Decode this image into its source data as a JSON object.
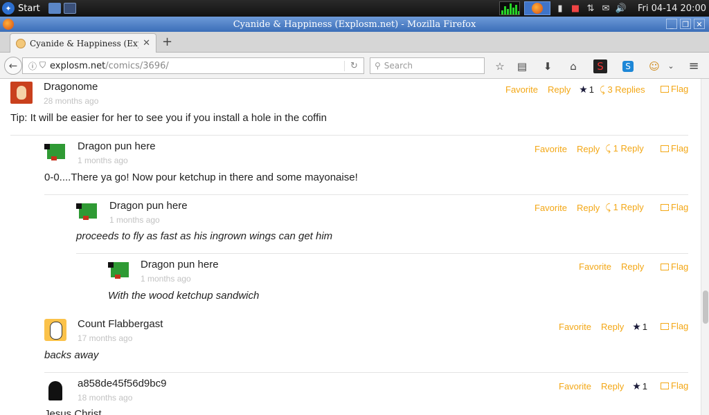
{
  "taskbar": {
    "start_label": "Start",
    "clock": "Fri 04-14 20:00"
  },
  "window": {
    "title": "Cyanide & Happiness (Explosm.net) - Mozilla Firefox"
  },
  "tab": {
    "title": "Cyanide & Happiness (Exp",
    "new_tab": "+"
  },
  "navbar": {
    "url_host": "explosm.net",
    "url_path": "/comics/3696/",
    "search_placeholder": "Search"
  },
  "comments": [
    {
      "name": "Dragonome",
      "time": "28 months ago",
      "text": "Tip: It will be easier for her to see you if you install a hole in the coffin",
      "favorite": "Favorite",
      "reply": "Reply",
      "stars": "1",
      "replies": "3 Replies",
      "flag": "Flag"
    },
    {
      "name": "Dragon pun here",
      "time": "1 months ago",
      "text": "0-0....There ya go! Now pour ketchup in there and some mayonaise!",
      "favorite": "Favorite",
      "reply": "Reply",
      "replies": "1 Reply",
      "flag": "Flag"
    },
    {
      "name": "Dragon pun here",
      "time": "1 months ago",
      "text": "proceeds to fly as fast as his ingrown wings can get him",
      "favorite": "Favorite",
      "reply": "Reply",
      "replies": "1 Reply",
      "flag": "Flag"
    },
    {
      "name": "Dragon pun here",
      "time": "1 months ago",
      "text": "With the wood ketchup sandwich",
      "favorite": "Favorite",
      "reply": "Reply",
      "flag": "Flag"
    },
    {
      "name": "Count Flabbergast",
      "time": "17 months ago",
      "text": "backs away",
      "favorite": "Favorite",
      "reply": "Reply",
      "stars": "1",
      "flag": "Flag"
    },
    {
      "name": "a858de45f56d9bc9",
      "time": "18 months ago",
      "text": "Jesus Christ",
      "favorite": "Favorite",
      "reply": "Reply",
      "stars": "1",
      "flag": "Flag"
    }
  ]
}
